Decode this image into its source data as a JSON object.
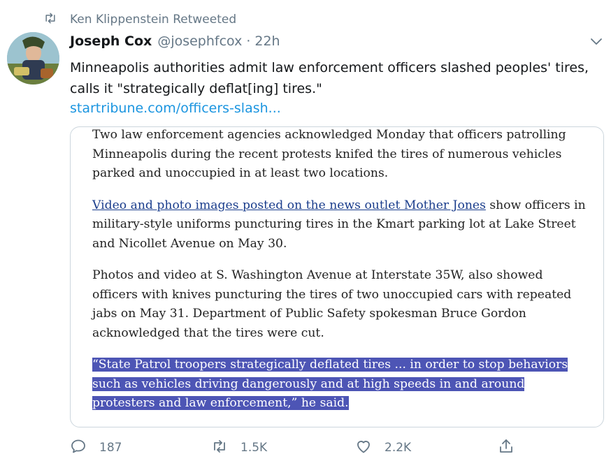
{
  "retweet": {
    "label": "Ken Klippenstein Retweeted"
  },
  "tweet": {
    "author_name": "Joseph Cox",
    "author_handle": "@josephfcox",
    "separator": "·",
    "time": "22h",
    "text": "Minneapolis authorities admit law enforcement officers slashed peoples' tires, calls it \"strategically deflat[ing] tires.\"",
    "link": "startribune.com/officers-slash..."
  },
  "article": {
    "p1": "Two law enforcement agencies acknowledged Monday that officers patrolling Minneapolis during the recent protests knifed the tires of numerous vehicles parked and unoccupied in at least two locations.",
    "p2_link": "Video and photo images posted on the news outlet Mother Jones",
    "p2_rest": " show officers in military-style uniforms puncturing tires in the Kmart parking lot at Lake Street and Nicollet Avenue on May 30.",
    "p3": "Photos and video at S. Washington Avenue at Interstate 35W, also showed officers with knives puncturing the tires of two unoccupied cars with repeated jabs on May 31. Department of Public Safety spokesman Bruce Gordon acknowledged that the tires were cut.",
    "p4_highlighted": "“State Patrol troopers strategically deflated tires ... in order to stop behaviors such as vehicles driving dangerously and at high speeds in and around protesters and law enforcement,” he said."
  },
  "actions": {
    "reply_count": "187",
    "retweet_count": "1.5K",
    "like_count": "2.2K",
    "icons": [
      "reply-icon",
      "retweet-icon",
      "like-icon",
      "share-icon"
    ]
  },
  "colors": {
    "link": "#1b95e0",
    "muted": "#657786",
    "highlight": "#4d55b5",
    "border": "#ccd6dd"
  }
}
